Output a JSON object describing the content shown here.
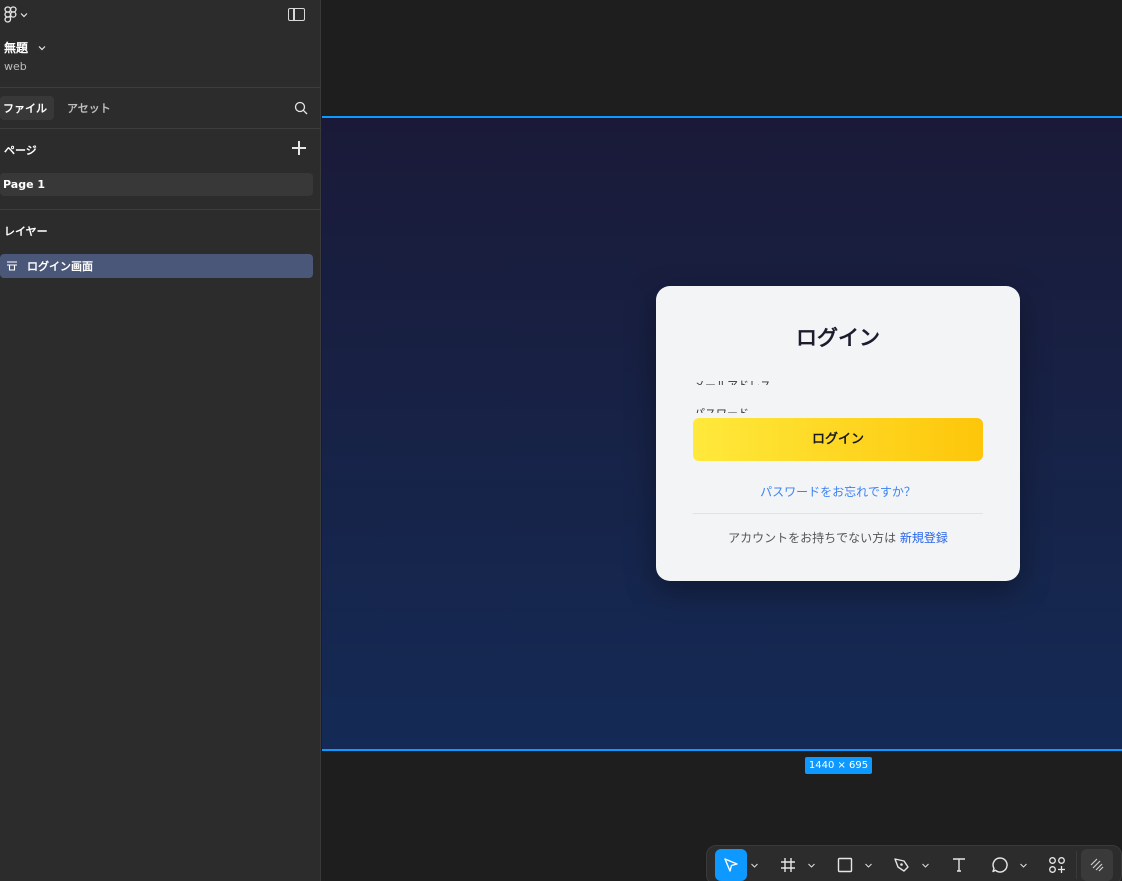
{
  "sidebar": {
    "file_title": "無題",
    "file_subtitle": "web",
    "tabs": [
      {
        "label": "ファイル"
      },
      {
        "label": "アセット"
      }
    ],
    "pages_label": "ページ",
    "pages": [
      {
        "label": "Page 1"
      }
    ],
    "layers_label": "レイヤー",
    "layers": [
      {
        "label": "ログイン画面"
      }
    ]
  },
  "canvas": {
    "frame_size": "1440 × 695",
    "frame_gradient": [
      "#1a1a38",
      "#142a55"
    ],
    "selection_color": "#0d99ff"
  },
  "login_card": {
    "title": "ログイン",
    "email_label": "メールアドレス",
    "password_label": "パスワード",
    "login_button": "ログイン",
    "forgot_link": "パスワードをお忘れですか？",
    "signup_prompt": "アカウントをお持ちでない方は",
    "signup_link": "新規登録",
    "button_gradient": [
      "#ffe93c",
      "#fdc60a"
    ],
    "link_color": "#3b82f6"
  },
  "toolbar": {
    "tools": [
      "move-tool-icon",
      "frame-tool-icon",
      "rectangle-tool-icon",
      "pen-tool-icon",
      "text-tool-icon",
      "comment-tool-icon",
      "actions-icon",
      "dev-mode-icon"
    ]
  }
}
